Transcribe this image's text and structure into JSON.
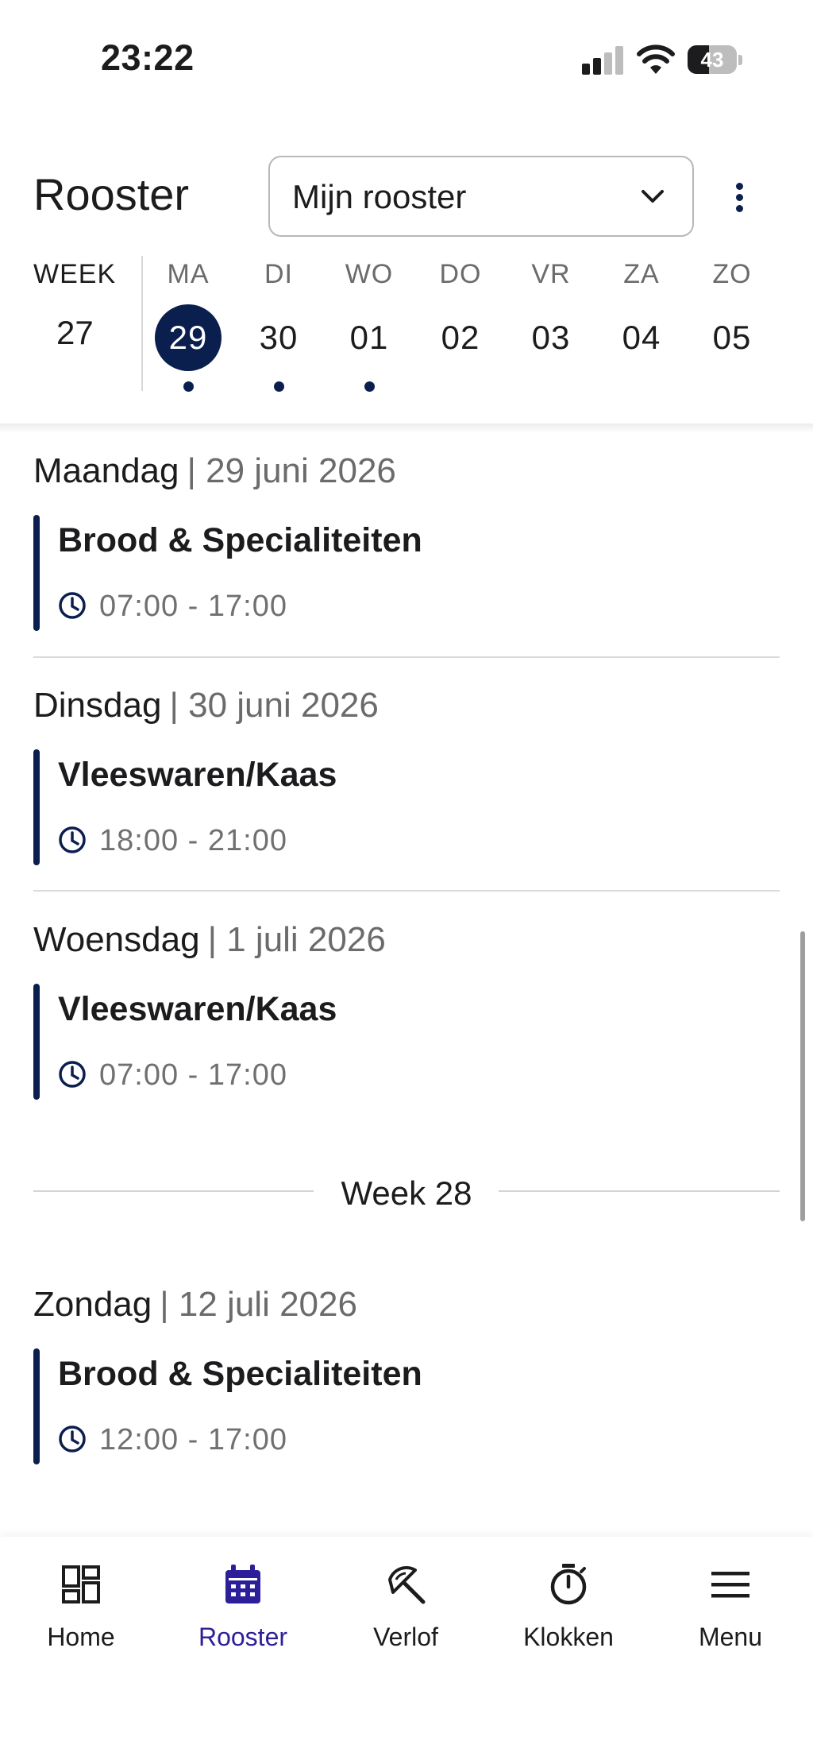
{
  "status_bar": {
    "time": "23:22",
    "battery": "43",
    "battery_level": 0.43
  },
  "header": {
    "title": "Rooster",
    "roster_select": {
      "value": "Mijn rooster"
    }
  },
  "week_strip": {
    "week_label": "WEEK",
    "week_number": "27",
    "days": [
      {
        "name": "MA",
        "num": "29",
        "selected": true,
        "has_shift": true
      },
      {
        "name": "DI",
        "num": "30",
        "selected": false,
        "has_shift": true
      },
      {
        "name": "WO",
        "num": "01",
        "selected": false,
        "has_shift": true
      },
      {
        "name": "DO",
        "num": "02",
        "selected": false,
        "has_shift": false
      },
      {
        "name": "VR",
        "num": "03",
        "selected": false,
        "has_shift": false
      },
      {
        "name": "ZA",
        "num": "04",
        "selected": false,
        "has_shift": false
      },
      {
        "name": "ZO",
        "num": "05",
        "selected": false,
        "has_shift": false
      }
    ]
  },
  "schedule": [
    {
      "day": "Maandag",
      "date": "| 29 juni 2026",
      "shift": "Brood & Specialiteiten",
      "time": "07:00 - 17:00"
    },
    {
      "day": "Dinsdag",
      "date": "| 30 juni 2026",
      "shift": "Vleeswaren/Kaas",
      "time": "18:00 - 21:00"
    },
    {
      "day": "Woensdag",
      "date": "| 1 juli 2026",
      "shift": "Vleeswaren/Kaas",
      "time": "07:00 - 17:00"
    },
    {
      "day": "Zondag",
      "date": "| 12 juli 2026",
      "shift": "Brood & Specialiteiten",
      "time": "12:00 - 17:00"
    }
  ],
  "week_separator": "Week 28",
  "bottom_nav": [
    {
      "label": "Home",
      "icon": "dashboard-icon",
      "active": false
    },
    {
      "label": "Rooster",
      "icon": "calendar-icon",
      "active": true
    },
    {
      "label": "Verlof",
      "icon": "beach-umbrella-icon",
      "active": false
    },
    {
      "label": "Klokken",
      "icon": "stopwatch-icon",
      "active": false
    },
    {
      "label": "Menu",
      "icon": "hamburger-menu-icon",
      "active": false
    }
  ],
  "colors": {
    "accent": "#0b1f4f",
    "nav_active": "#2d1f9a",
    "muted_text": "#6b6b6b"
  }
}
